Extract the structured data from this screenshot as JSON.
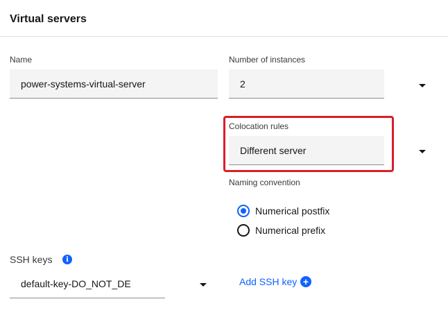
{
  "section": {
    "title": "Virtual servers"
  },
  "name_field": {
    "label": "Name",
    "value": "power-systems-virtual-server"
  },
  "instances_field": {
    "label": "Number of instances",
    "value": "2"
  },
  "colocation_field": {
    "label": "Colocation rules",
    "value": "Different server"
  },
  "naming": {
    "label": "Naming convention",
    "options": [
      {
        "label": "Numerical postfix",
        "checked": true
      },
      {
        "label": "Numerical prefix",
        "checked": false
      }
    ]
  },
  "ssh": {
    "label": "SSH keys",
    "info_icon": "info-icon",
    "value": "default-key-DO_NOT_DE",
    "add_label": "Add SSH key",
    "add_icon": "plus-circle-icon"
  },
  "colors": {
    "accent": "#0f62fe",
    "highlight": "#da1e28",
    "field_bg": "#f4f4f4"
  }
}
